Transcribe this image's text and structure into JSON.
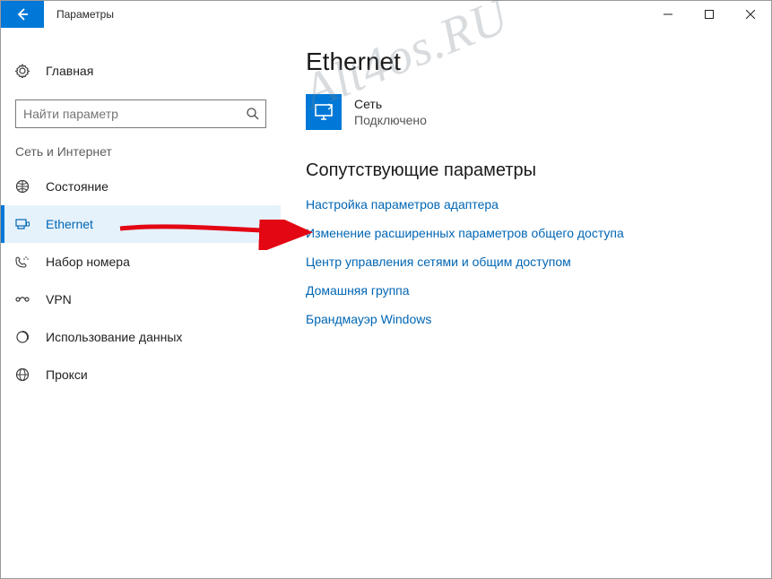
{
  "window": {
    "title": "Параметры"
  },
  "sidebar": {
    "home_label": "Главная",
    "search_placeholder": "Найти параметр",
    "category_label": "Сеть и Интернет",
    "items": [
      {
        "key": "status",
        "label": "Состояние",
        "selected": false
      },
      {
        "key": "ethernet",
        "label": "Ethernet",
        "selected": true
      },
      {
        "key": "dialup",
        "label": "Набор номера",
        "selected": false
      },
      {
        "key": "vpn",
        "label": "VPN",
        "selected": false
      },
      {
        "key": "datausage",
        "label": "Использование данных",
        "selected": false
      },
      {
        "key": "proxy",
        "label": "Прокси",
        "selected": false
      }
    ]
  },
  "main": {
    "page_title": "Ethernet",
    "network": {
      "name": "Сеть",
      "status": "Подключено"
    },
    "related_heading": "Сопутствующие параметры",
    "links": [
      "Настройка параметров адаптера",
      "Изменение расширенных параметров общего доступа",
      "Центр управления сетями и общим доступом",
      "Домашняя группа",
      "Брандмауэр Windows"
    ]
  },
  "annotation": {
    "watermark": "Alt4os.RU"
  }
}
